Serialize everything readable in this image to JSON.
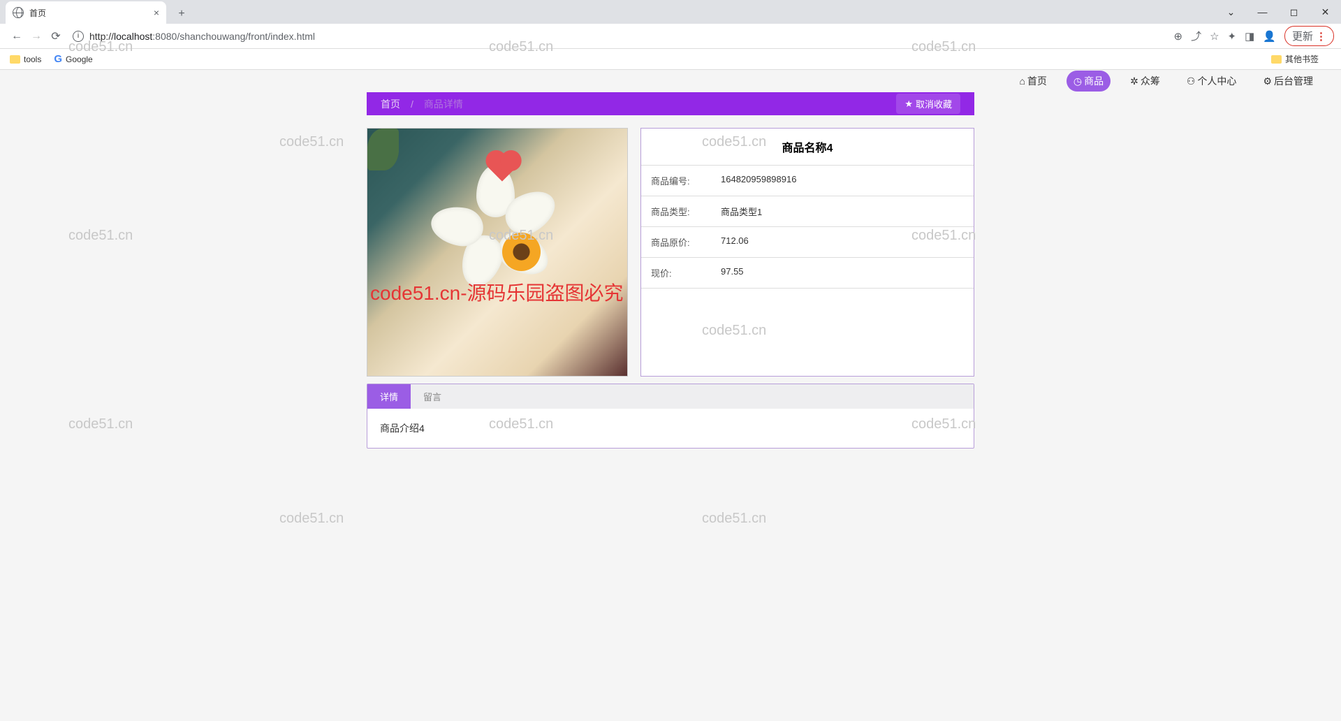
{
  "browser": {
    "tab_title": "首页",
    "url_host": "localhost",
    "url_port": ":8080",
    "url_path": "/shanchouwang/front/index.html",
    "update_label": "更新"
  },
  "bookmarks": {
    "tools": "tools",
    "google": "Google",
    "other": "其他书签"
  },
  "nav": {
    "home": "首页",
    "product": "商品",
    "crowd": "众筹",
    "personal": "个人中心",
    "admin": "后台管理"
  },
  "breadcrumb": {
    "home": "首页",
    "current": "商品详情",
    "fav_button": "取消收藏"
  },
  "product": {
    "title": "商品名称4",
    "fields": {
      "id_label": "商品编号:",
      "id_value": "164820959898916",
      "type_label": "商品类型:",
      "type_value": "商品类型1",
      "origprice_label": "商品原价:",
      "origprice_value": "712.06",
      "price_label": "现价:",
      "price_value": "97.55"
    }
  },
  "tabs": {
    "detail": "详情",
    "comment": "留言"
  },
  "detail_content": "商品介绍4",
  "watermarks": {
    "text": "code51.cn",
    "red": "code51.cn-源码乐园盗图必究"
  }
}
